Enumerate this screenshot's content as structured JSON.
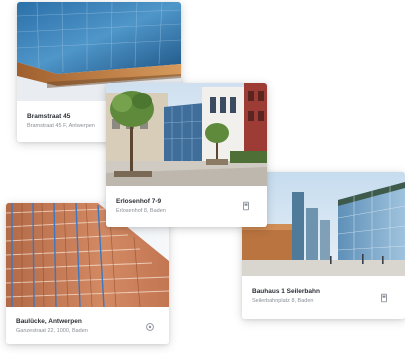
{
  "cards": [
    {
      "title": "Bramstraat 45",
      "subtitle": "Bramstraat 45 F, Antwerpen",
      "icon": "none"
    },
    {
      "title": "Erlosenhof 7-9",
      "subtitle": "Erlosenhof 8, Baden",
      "icon": "bookmark-icon"
    },
    {
      "title": "Baulücke, Antwerpen",
      "subtitle": "Ganzestraat 22, 1000, Baden",
      "icon": "location-icon"
    },
    {
      "title": "Bauhaus 1 Seilerbahn",
      "subtitle": "Seilerbahnplatz 8, Baden",
      "icon": "bookmark-icon"
    }
  ],
  "colors": {
    "card_background": "#ffffff",
    "title": "#2c2f36",
    "subtitle": "#8a8f98",
    "icon": "#8a8f98"
  }
}
